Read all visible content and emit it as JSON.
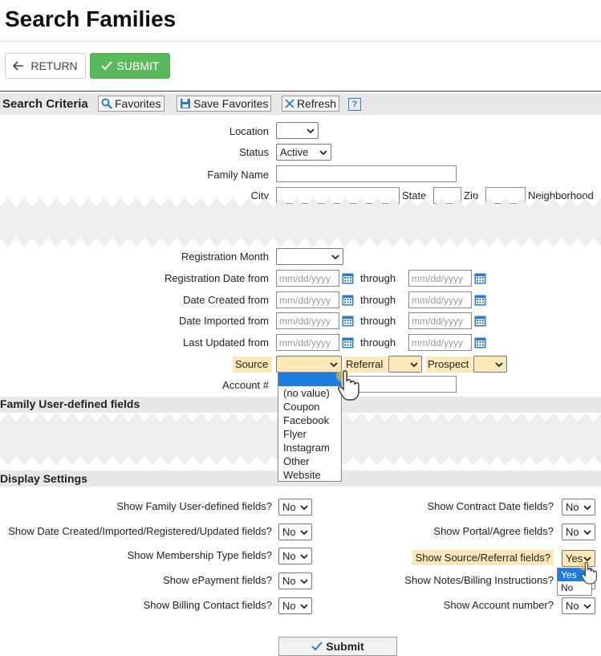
{
  "page_title": "Search Families",
  "toolbar": {
    "return_label": "RETURN",
    "submit_label": "SUBMIT"
  },
  "criteria": {
    "title": "Search Criteria",
    "favorites_label": "Favorites",
    "save_favorites_label": "Save Favorites",
    "refresh_label": "Refresh",
    "help_label": "?"
  },
  "fields": {
    "location_label": "Location",
    "status_label": "Status",
    "status_value": "Active",
    "family_name_label": "Family Name",
    "city_label": "City",
    "state_label": "State",
    "zip_label": "Zip",
    "neighborhood_label": "Neighborhood",
    "registration_month_label": "Registration Month",
    "registration_date_label": "Registration Date from",
    "date_created_label": "Date Created from",
    "date_imported_label": "Date Imported from",
    "last_updated_label": "Last Updated from",
    "through_label": "through",
    "date_placeholder": "mm/dd/yyyy",
    "source_label": "Source",
    "referral_label": "Referral",
    "prospect_label": "Prospect",
    "account_label": "Account #"
  },
  "source_dropdown": {
    "options": [
      "(no value)",
      "Coupon",
      "Facebook",
      "Flyer",
      "Instagram",
      "Other",
      "Website"
    ]
  },
  "user_defined": {
    "title": "Family User-defined fields"
  },
  "display": {
    "title": "Display Settings",
    "left": [
      {
        "label": "Show Family User-defined fields?",
        "value": "No"
      },
      {
        "label": "Show Date Created/Imported/Registered/Updated fields?",
        "value": "No"
      },
      {
        "label": "Show Membership Type fields?",
        "value": "No"
      },
      {
        "label": "Show ePayment fields?",
        "value": "No"
      },
      {
        "label": "Show Billing Contact fields?",
        "value": "No"
      }
    ],
    "right": [
      {
        "label": "Show Contract Date fields?",
        "value": "No"
      },
      {
        "label": "Show Portal/Agree fields?",
        "value": "No"
      },
      {
        "label": "Show Source/Referral fields?",
        "value": "Yes"
      },
      {
        "label": "Show Notes/Billing Instructions?",
        "value": ""
      },
      {
        "label": "Show Account number?",
        "value": "No"
      }
    ],
    "yes_no_options": [
      "Yes",
      "No"
    ]
  },
  "submit_bottom_label": "Submit",
  "colors": {
    "accent_green": "#5cb85c",
    "highlight": "#fde9b7",
    "select_blue": "#1e7be0",
    "icon_blue": "#2b7bd1"
  }
}
